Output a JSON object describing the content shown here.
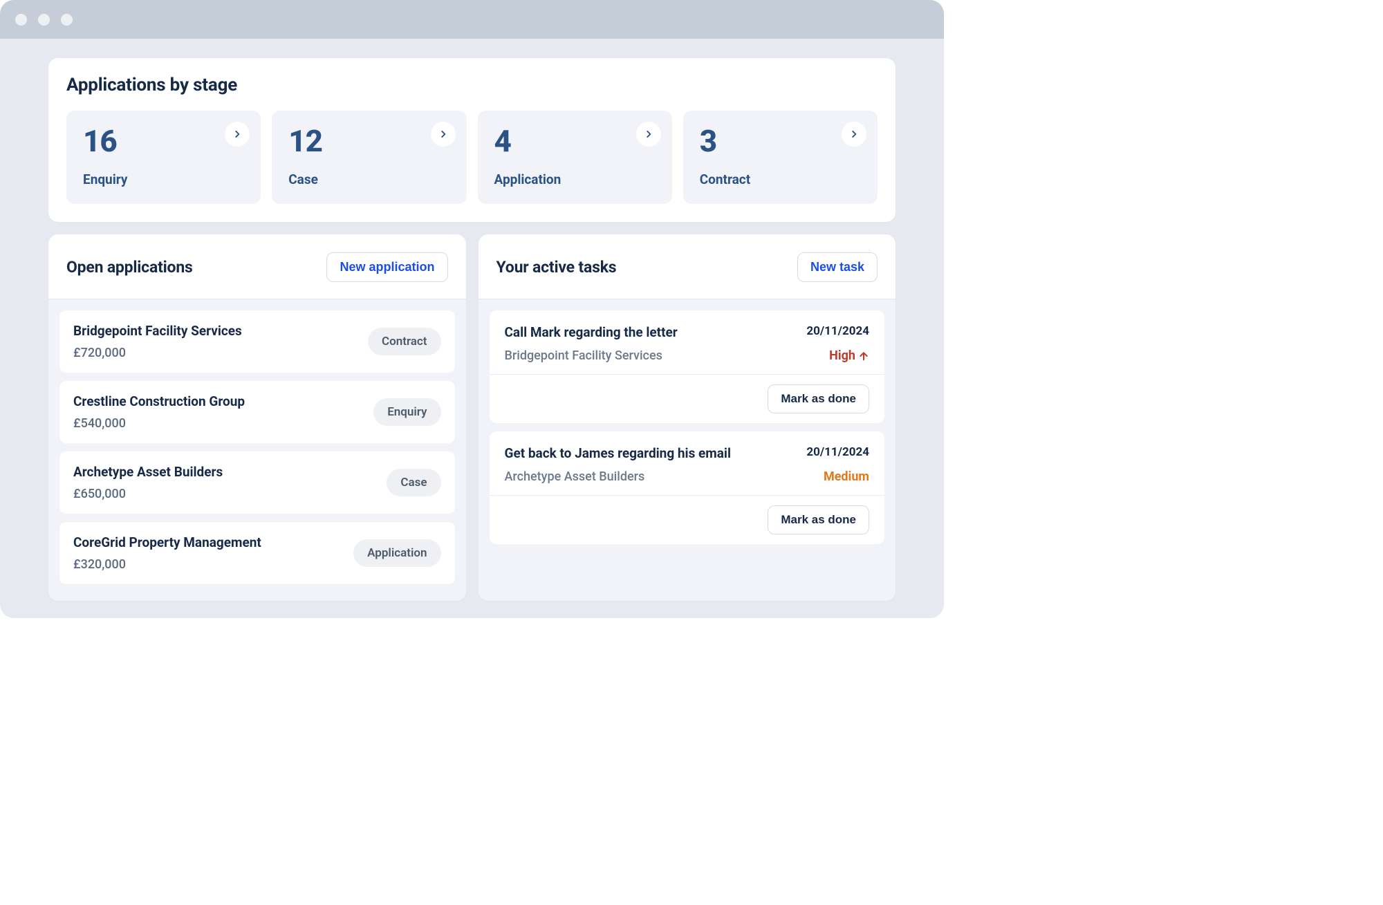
{
  "stages": {
    "title": "Applications by stage",
    "cards": [
      {
        "count": "16",
        "label": "Enquiry"
      },
      {
        "count": "12",
        "label": "Case"
      },
      {
        "count": "4",
        "label": "Application"
      },
      {
        "count": "3",
        "label": "Contract"
      }
    ]
  },
  "open_apps": {
    "title": "Open applications",
    "new_btn": "New application",
    "items": [
      {
        "name": "Bridgepoint Facility Services",
        "amount": "£720,000",
        "stage": "Contract"
      },
      {
        "name": "Crestline Construction Group",
        "amount": "£540,000",
        "stage": "Enquiry"
      },
      {
        "name": "Archetype Asset Builders",
        "amount": "£650,000",
        "stage": "Case"
      },
      {
        "name": "CoreGrid Property Management",
        "amount": "£320,000",
        "stage": "Application"
      }
    ]
  },
  "tasks": {
    "title": "Your active tasks",
    "new_btn": "New task",
    "done_btn": "Mark as done",
    "items": [
      {
        "title": "Call Mark regarding the letter",
        "date": "20/11/2024",
        "org": "Bridgepoint Facility Services",
        "priority": "High",
        "priority_class": "high",
        "arrow": true
      },
      {
        "title": "Get back to James regarding his email",
        "date": "20/11/2024",
        "org": "Archetype Asset Builders",
        "priority": "Medium",
        "priority_class": "medium",
        "arrow": false
      }
    ]
  }
}
